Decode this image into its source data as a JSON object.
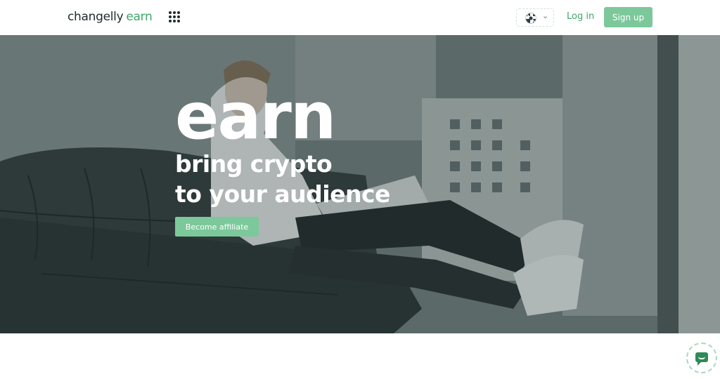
{
  "header": {
    "logo_main": "changelly",
    "logo_accent": "earn",
    "login_label": "Log in",
    "signup_label": "Sign up"
  },
  "hero": {
    "title": "earn",
    "subtitle_line1": "bring crypto",
    "subtitle_line2": "to your audience",
    "cta_label": "Become affiliate"
  },
  "colors": {
    "accent": "#3fa66b",
    "button": "#7cc89b",
    "text_dark": "#1f2a2e"
  },
  "icons": {
    "apps": "apps-grid-icon",
    "language": "uk-flag-icon",
    "chat": "chat-icon"
  }
}
